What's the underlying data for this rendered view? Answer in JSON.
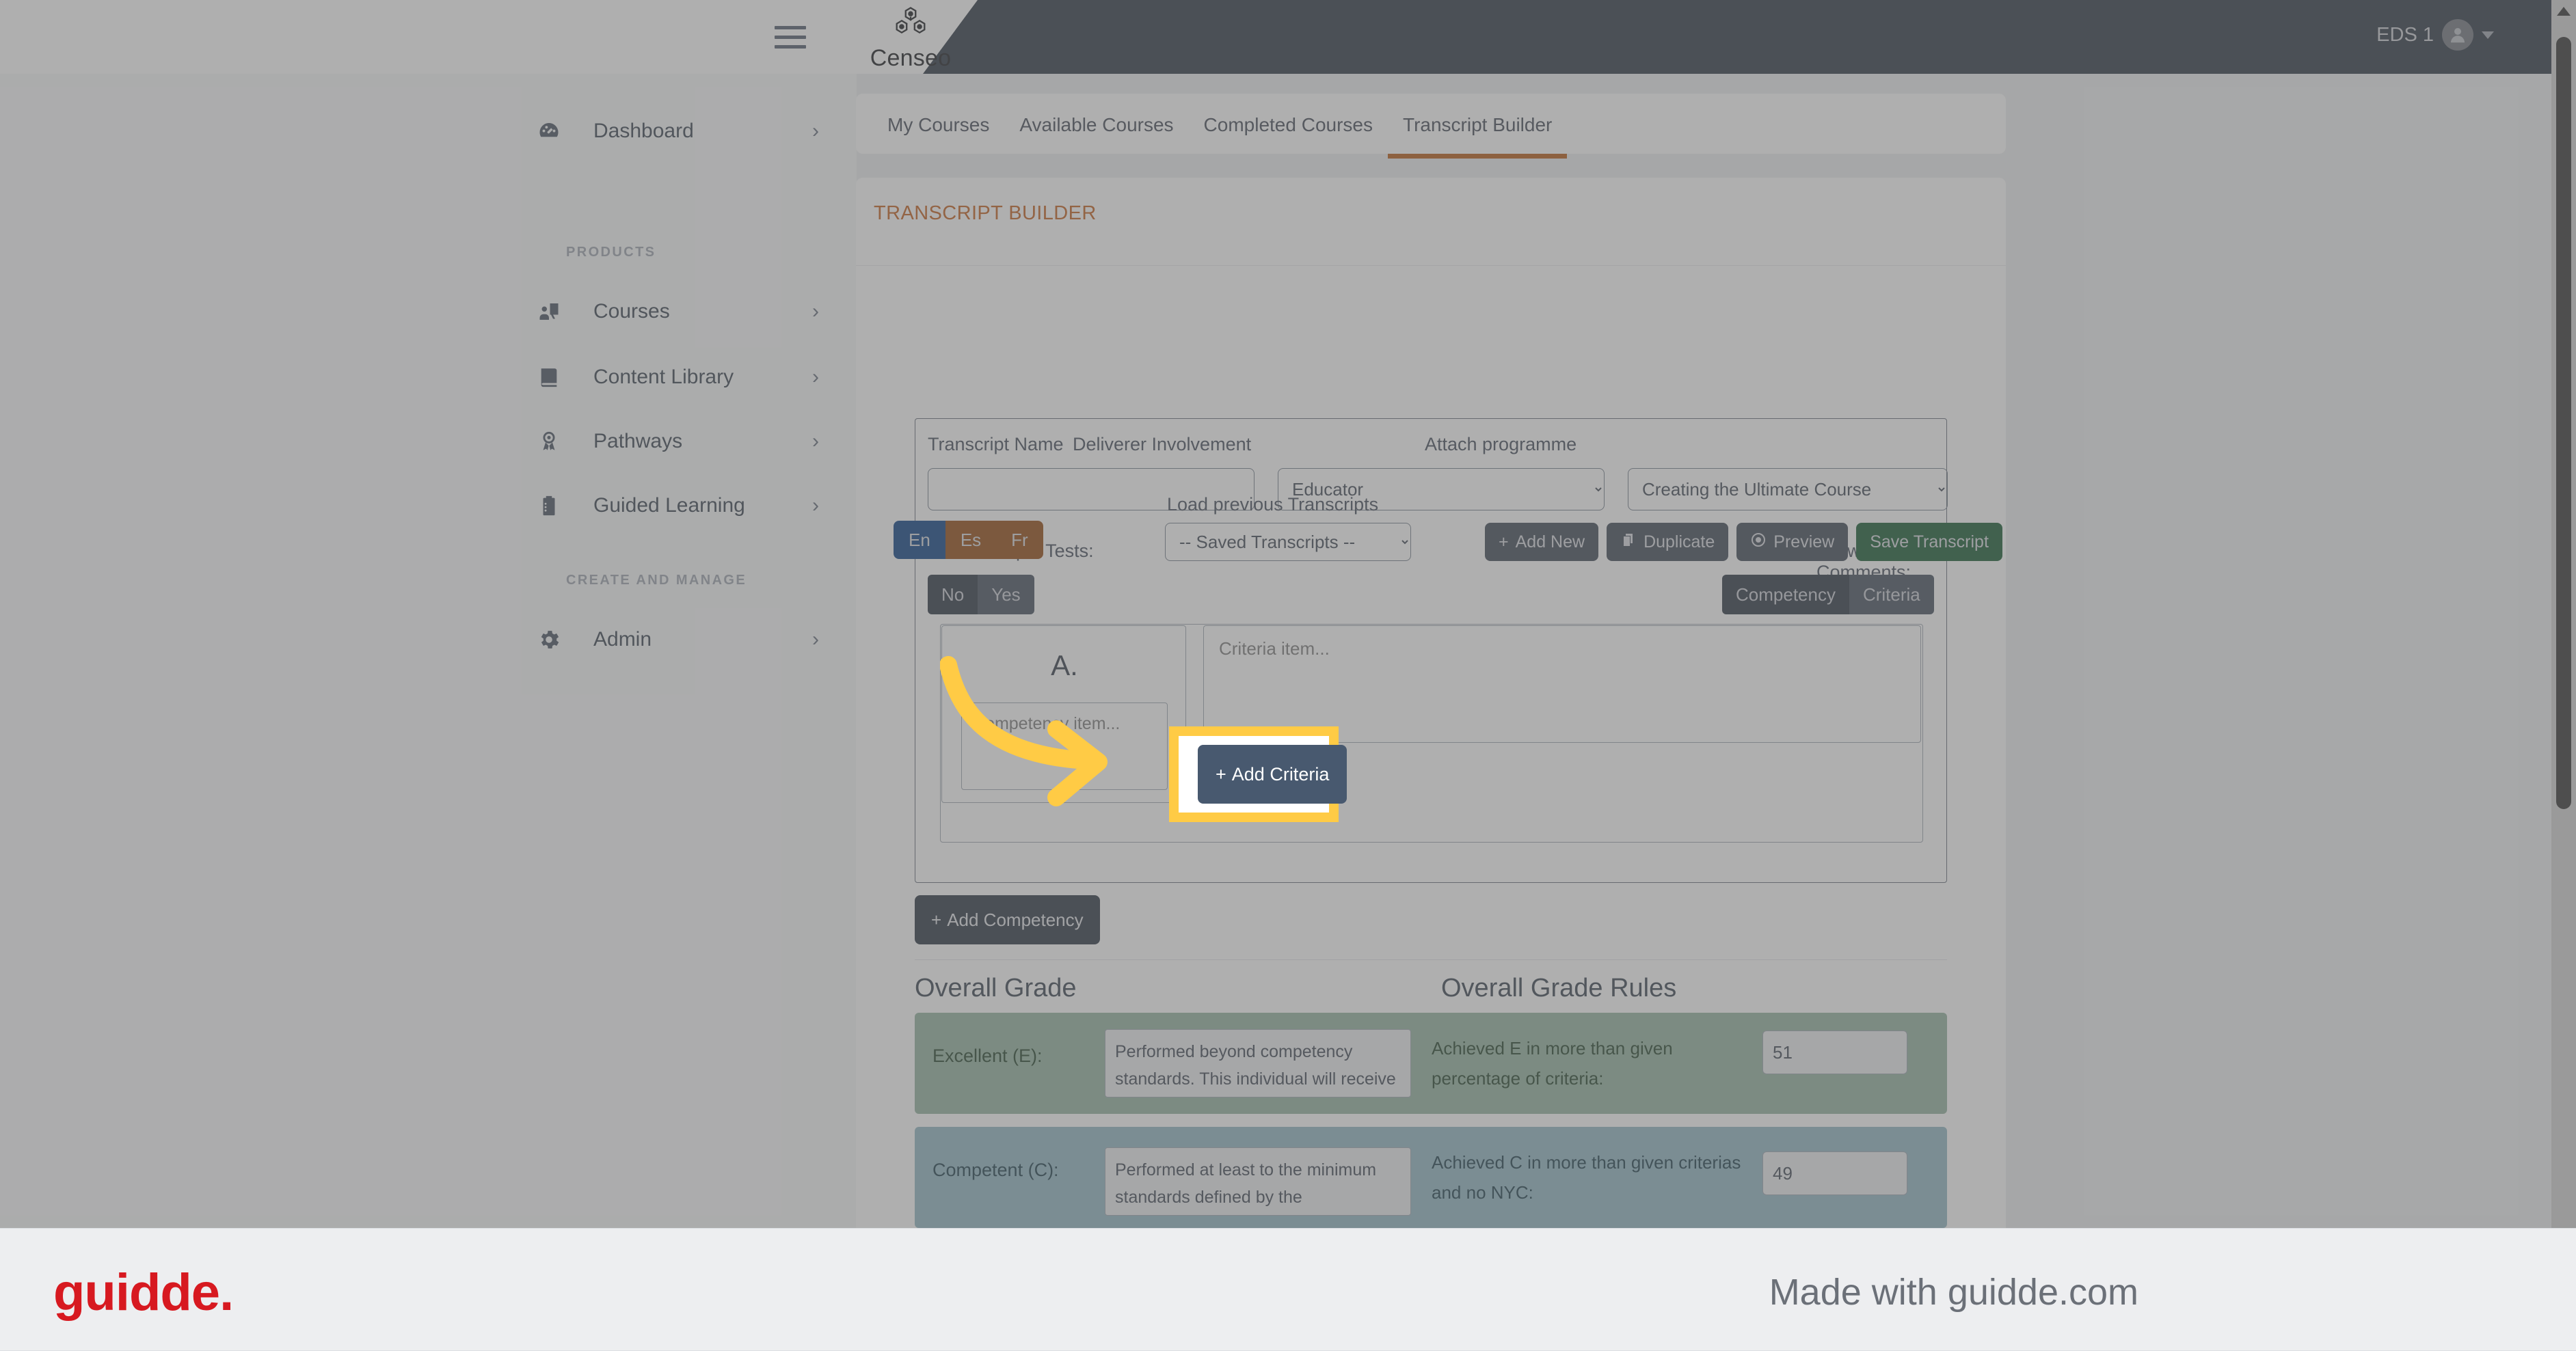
{
  "topbar": {
    "brand_name": "Censeo",
    "brand_logo_icon": "hexagon-molecule-logo",
    "hamburger_icon": "hamburger-menu-icon",
    "user_name": "EDS 1",
    "user_avatar_icon": "user-avatar-icon",
    "caret_icon": "caret-down-icon"
  },
  "sidebar": {
    "items": [
      {
        "label": "Dashboard",
        "icon": "gauge-icon",
        "chevron": "›"
      },
      {
        "label": "Courses",
        "icon": "presentation-person-icon",
        "chevron": "›"
      },
      {
        "label": "Content Library",
        "icon": "book-icon",
        "chevron": "›"
      },
      {
        "label": "Pathways",
        "icon": "award-ribbon-icon",
        "chevron": "›"
      },
      {
        "label": "Guided Learning",
        "icon": "clipboard-list-icon",
        "chevron": "›"
      },
      {
        "label": "Admin",
        "icon": "gear-icon",
        "chevron": "›"
      }
    ],
    "headings": {
      "products": "PRODUCTS",
      "create_and_manage": "CREATE AND MANAGE"
    }
  },
  "tabs": [
    {
      "label": "My Courses",
      "active": false
    },
    {
      "label": "Available Courses",
      "active": false
    },
    {
      "label": "Completed Courses",
      "active": false
    },
    {
      "label": "Transcript Builder",
      "active": true
    }
  ],
  "main": {
    "card_title": "TRANSCRIPT BUILDER",
    "load_previous_label": "Load previous Transcripts",
    "saved_select_value": "-- Saved Transcripts --",
    "languages": [
      {
        "code": "En",
        "active": true
      },
      {
        "code": "Es",
        "active": false
      },
      {
        "code": "Fr",
        "active": false
      }
    ],
    "buttons": [
      {
        "label": "Add New",
        "icon": "plus-icon",
        "style": "dark"
      },
      {
        "label": "Duplicate",
        "icon": "copy-icon",
        "style": "dark"
      },
      {
        "label": "Preview",
        "icon": "eye-icon",
        "style": "dark"
      },
      {
        "label": "Save Transcript",
        "icon": "",
        "style": "green"
      }
    ],
    "form": {
      "transcript_name_label": "Transcript Name",
      "transcript_name_value": "",
      "deliverer_label": "Deliverer Involvement",
      "deliverer_value": "Educator",
      "attach_programme_label": "Attach programme",
      "attach_programme_value": "Creating the Ultimate Course",
      "allow_multiple_tests_label": "Allow Multiple Tests:",
      "allow_multiple_tests": [
        {
          "label": "No",
          "active": true
        },
        {
          "label": "Yes",
          "active": false
        }
      ],
      "allow_comments_label": "Allow Comments:",
      "allow_comments": [
        {
          "label": "Competency",
          "active": true
        },
        {
          "label": "Criteria",
          "active": false
        }
      ]
    },
    "competency": {
      "letter": "A.",
      "competency_placeholder": "Competency item...",
      "criteria_placeholder": "Criteria item...",
      "add_criteria_label": "Add Criteria",
      "add_criteria_icon": "plus-icon",
      "add_competency_label": "Add Competency",
      "add_competency_icon": "plus-icon"
    },
    "overall_grade": {
      "title": "Overall Grade",
      "rules_title": "Overall Grade Rules",
      "rows": [
        {
          "label": "Excellent (E):",
          "description": "Performed beyond competency standards. This individual will receive",
          "rule": "Achieved E in more than given percentage of criteria:",
          "value": "51",
          "color": "#8fb09b"
        },
        {
          "label": "Competent (C):",
          "description": "Performed at least to the minimum standards defined by the competencies",
          "rule": "Achieved C in more than given criterias and no NYC:",
          "value": "49",
          "color": "#8cb3c2"
        }
      ]
    }
  },
  "footer": {
    "logo_text": "guidde.",
    "made_with": "Made with guidde.com"
  },
  "colors": {
    "accent_orange": "#c05a16",
    "dark_navy": "#232d3b",
    "highlight_yellow": "#ffcb45",
    "green_button": "#0d5229",
    "brand_red": "#d71920"
  }
}
